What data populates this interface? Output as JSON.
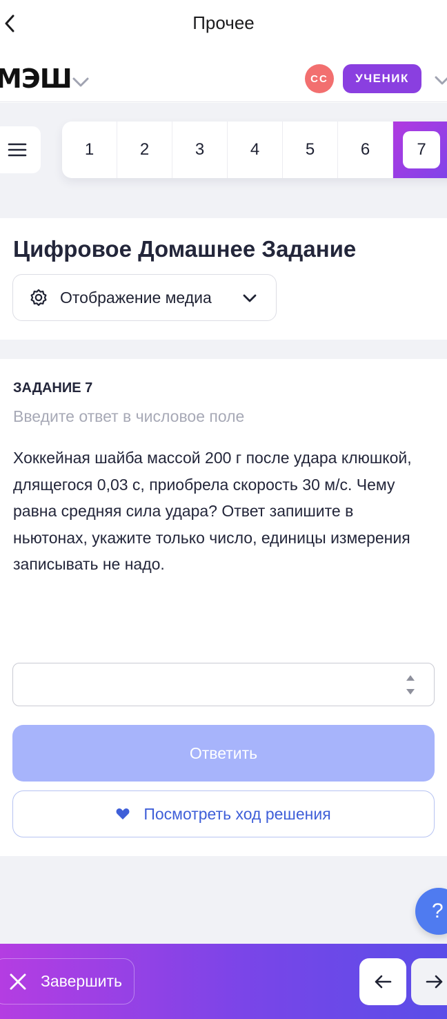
{
  "topbar": {
    "title": "Прочее",
    "back_icon": "chevron-left-icon"
  },
  "header": {
    "logo": "МЭШ",
    "logo_menu_icon": "chevron-down-icon",
    "avatar_initials": "СС",
    "role": "УЧЕНИК",
    "role_menu_icon": "chevron-down-icon"
  },
  "task_nav": {
    "menu_icon": "hamburger-icon",
    "tasks": [
      "1",
      "2",
      "3",
      "4",
      "5",
      "6",
      "7"
    ],
    "active": "7"
  },
  "title_section": {
    "title": "Цифровое Домашнее Задание",
    "media_button": "Отображение медиа",
    "media_icon": "gear-icon"
  },
  "task": {
    "label": "ЗАДАНИЕ 7",
    "hint": "Введите ответ в числовое поле",
    "text": "Хоккейная шайба массой 200 г после удара клюшкой, длящегося 0,03 с, приобрела скорость 30 м/с. Чему равна средняя сила удара? Ответ запишите в ньютонах, укажите только число, единицы измерения записывать не надо.",
    "answer_value": "",
    "submit": "Ответить",
    "solution": "Посмотреть ход решения",
    "solution_icon": "heart-icon"
  },
  "help": {
    "label": "?"
  },
  "bottom_bar": {
    "finish": "Завершить",
    "finish_icon": "close-icon",
    "prev_icon": "arrow-left-icon",
    "next_icon": "arrow-right-icon"
  },
  "colors": {
    "accent_purple": "#8a3fe0",
    "avatar_red": "#f26f6f",
    "submit_disabled": "#a7b4fb",
    "link_blue": "#3f5fd8",
    "help_blue": "#4f7bf0"
  }
}
